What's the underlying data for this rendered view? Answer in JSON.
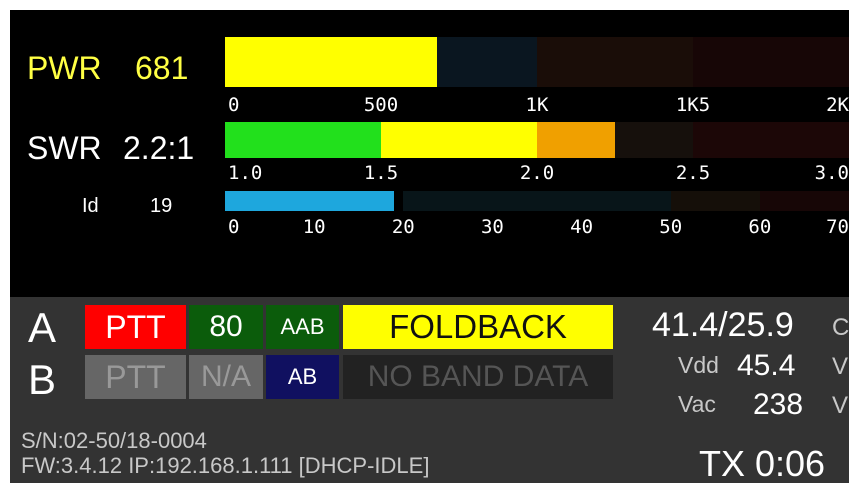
{
  "meters": {
    "pwr": {
      "label": "PWR",
      "value": "681",
      "level_watts": 681,
      "scale_max": 2000,
      "ticks": [
        "0",
        "500",
        "1K",
        "1K5",
        "2K"
      ],
      "zone_colors": [
        "#0a1620",
        "#1a0d08",
        "#170606",
        "#1c0707"
      ],
      "fill_color": "#ffff00"
    },
    "swr": {
      "label": "SWR",
      "value": "2.2:1",
      "level_ratio": 2.25,
      "scale_min": 1.0,
      "scale_max": 3.0,
      "ticks": [
        "1.0",
        "1.5",
        "2.0",
        "2.5",
        "3.0"
      ],
      "fill_colors": [
        "#22e01c",
        "#ffff00",
        "#f0a000"
      ],
      "zone_colors": [
        "#16100c",
        "#1c0707"
      ]
    },
    "id": {
      "label": "Id",
      "value": "19",
      "level_amps": 19,
      "scale_max": 70,
      "ticks": [
        "0",
        "10",
        "20",
        "30",
        "40",
        "50",
        "60",
        "70"
      ],
      "fill_color": "#1ea7dd",
      "zone_colors": [
        "#081519",
        "#150f09",
        "#170606"
      ]
    }
  },
  "rows": {
    "a": {
      "letter": "A",
      "ptt": "PTT",
      "band": "80",
      "antenna": "AAB",
      "status": "FOLDBACK"
    },
    "b": {
      "letter": "B",
      "ptt": "PTT",
      "band": "N/A",
      "antenna": "AB",
      "status": "NO BAND DATA"
    }
  },
  "readouts": {
    "temp": "41.4/25.9",
    "temp_unit": "C",
    "vdd_label": "Vdd",
    "vdd_value": "45.4",
    "vdd_unit": "V",
    "vac_label": "Vac",
    "vac_value": "238",
    "vac_unit": "V",
    "tx": "TX 0:06"
  },
  "footer": {
    "serial": "S/N:02-50/18-0004",
    "firmware_ip": "FW:3.4.12  IP:192.168.1.111 [DHCP-IDLE]"
  },
  "colors": {
    "ptt_active": "#ff0000",
    "ptt_inactive": "#666666",
    "band_active": "#0b5c0b",
    "band_inactive": "#666666",
    "antenna_a": "#0b5c0b",
    "antenna_b": "#101060",
    "status_warning": "#ffff00",
    "status_inactive": "#222222",
    "pwr_label": "#ffff44"
  }
}
